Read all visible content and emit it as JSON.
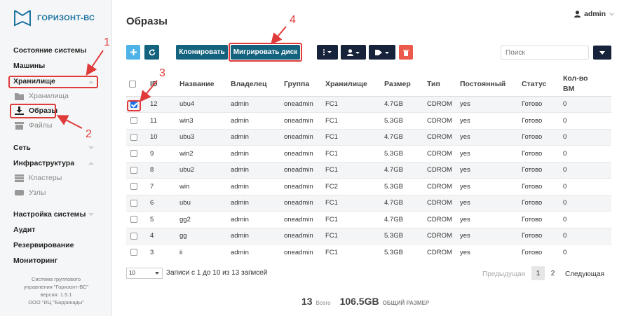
{
  "app": {
    "logo_text": "ГОРИЗОНТ-ВС",
    "page_title": "Образы",
    "user": "admin"
  },
  "sidebar": {
    "system_status": "Состояние системы",
    "machines": "Машины",
    "storage": "Хранилище",
    "storage_sub": "Хранилища",
    "images": "Образы",
    "files": "Файлы",
    "network": "Сеть",
    "infrastructure": "Инфраструктура",
    "clusters": "Кластеры",
    "nodes": "Узлы",
    "settings": "Настройка системы",
    "audit": "Аудит",
    "backup": "Резервирование",
    "monitoring": "Мониторинг",
    "footer": [
      "Система группового",
      "управления \"Горизонт-ВС\"",
      "версия: 1.5.1",
      "ООО \"ИЦ \"Баррикады\""
    ]
  },
  "annotations": [
    "1",
    "2",
    "3",
    "4"
  ],
  "toolbar": {
    "add_icon": "plus-icon",
    "refresh_icon": "refresh-icon",
    "clone_label": "Клонировать",
    "migrate_label": "Мигрировать диск",
    "search_placeholder": "Поиск",
    "colors": {
      "teal": "#13627e",
      "blue": "#4fb3e8",
      "dark": "#17223b",
      "red": "#ec5a4b"
    }
  },
  "table": {
    "headers": [
      "ID",
      "Название",
      "Владелец",
      "Группа",
      "Хранилище",
      "Размер",
      "Тип",
      "Постоянный",
      "Статус",
      "Кол-во",
      "ВМ"
    ],
    "rows": [
      {
        "id": "12",
        "name": "ubu4",
        "owner": "admin",
        "group": "oneadmin",
        "ds": "FC1",
        "size": "4.7GB",
        "type": "CDROM",
        "persistent": "yes",
        "status": "Готово",
        "vms": "0",
        "checked": true
      },
      {
        "id": "11",
        "name": "win3",
        "owner": "admin",
        "group": "oneadmin",
        "ds": "FC1",
        "size": "5.3GB",
        "type": "CDROM",
        "persistent": "yes",
        "status": "Готово",
        "vms": "0"
      },
      {
        "id": "10",
        "name": "ubu3",
        "owner": "admin",
        "group": "oneadmin",
        "ds": "FC1",
        "size": "4.7GB",
        "type": "CDROM",
        "persistent": "yes",
        "status": "Готово",
        "vms": "0"
      },
      {
        "id": "9",
        "name": "win2",
        "owner": "admin",
        "group": "oneadmin",
        "ds": "FC1",
        "size": "5.3GB",
        "type": "CDROM",
        "persistent": "yes",
        "status": "Готово",
        "vms": "0"
      },
      {
        "id": "8",
        "name": "ubu2",
        "owner": "admin",
        "group": "oneadmin",
        "ds": "FC1",
        "size": "4.7GB",
        "type": "CDROM",
        "persistent": "yes",
        "status": "Готово",
        "vms": "0"
      },
      {
        "id": "7",
        "name": "win",
        "owner": "admin",
        "group": "oneadmin",
        "ds": "FC2",
        "size": "5.3GB",
        "type": "CDROM",
        "persistent": "yes",
        "status": "Готово",
        "vms": "0"
      },
      {
        "id": "6",
        "name": "ubu",
        "owner": "admin",
        "group": "oneadmin",
        "ds": "FC1",
        "size": "4.7GB",
        "type": "CDROM",
        "persistent": "yes",
        "status": "Готово",
        "vms": "0"
      },
      {
        "id": "5",
        "name": "gg2",
        "owner": "admin",
        "group": "oneadmin",
        "ds": "FC1",
        "size": "4.7GB",
        "type": "CDROM",
        "persistent": "yes",
        "status": "Готово",
        "vms": "0"
      },
      {
        "id": "4",
        "name": "gg",
        "owner": "admin",
        "group": "oneadmin",
        "ds": "FC1",
        "size": "5.3GB",
        "type": "CDROM",
        "persistent": "yes",
        "status": "Готово",
        "vms": "0"
      },
      {
        "id": "3",
        "name": "ii",
        "owner": "admin",
        "group": "oneadmin",
        "ds": "FC1",
        "size": "5.3GB",
        "type": "CDROM",
        "persistent": "yes",
        "status": "Готово",
        "vms": "0"
      }
    ]
  },
  "pagination": {
    "page_size": "10",
    "info": "Записи с 1 до 10 из 13 записей",
    "prev": "Предыдущая",
    "pages": [
      "1",
      "2"
    ],
    "next": "Следующая"
  },
  "totals": {
    "count": "13",
    "count_label": "Всего",
    "size": "106.5GB",
    "size_label": "ОБЩИЙ РАЗМЕР"
  }
}
